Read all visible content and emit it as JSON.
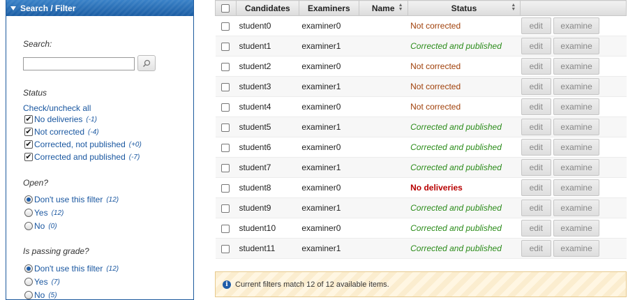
{
  "sidebar": {
    "title": "Search / Filter",
    "search_label": "Search:",
    "search_value": "",
    "status_label": "Status",
    "check_uncheck_all": "Check/uncheck all",
    "status_options": [
      {
        "label": "No deliveries",
        "count": "(-1)"
      },
      {
        "label": "Not corrected",
        "count": "(-4)"
      },
      {
        "label": "Corrected, not published",
        "count": "(+0)"
      },
      {
        "label": "Corrected and published",
        "count": "(-7)"
      }
    ],
    "open_label": "Open?",
    "open_options": [
      {
        "label": "Don't use this filter",
        "count": "(12)",
        "selected": true
      },
      {
        "label": "Yes",
        "count": "(12)",
        "selected": false
      },
      {
        "label": "No",
        "count": "(0)",
        "selected": false
      }
    ],
    "passing_label": "Is passing grade?",
    "passing_options": [
      {
        "label": "Don't use this filter",
        "count": "(12)",
        "selected": true
      },
      {
        "label": "Yes",
        "count": "(7)",
        "selected": false
      },
      {
        "label": "No",
        "count": "(5)",
        "selected": false
      }
    ]
  },
  "table": {
    "headers": [
      "Candidates",
      "Examiners",
      "Name",
      "Status"
    ],
    "edit_label": "edit",
    "examine_label": "examine",
    "rows": [
      {
        "candidate": "student0",
        "examiner": "examiner0",
        "status": "Not corrected",
        "kind": "nc"
      },
      {
        "candidate": "student1",
        "examiner": "examiner1",
        "status": "Corrected and published",
        "kind": "cp"
      },
      {
        "candidate": "student2",
        "examiner": "examiner0",
        "status": "Not corrected",
        "kind": "nc"
      },
      {
        "candidate": "student3",
        "examiner": "examiner1",
        "status": "Not corrected",
        "kind": "nc"
      },
      {
        "candidate": "student4",
        "examiner": "examiner0",
        "status": "Not corrected",
        "kind": "nc"
      },
      {
        "candidate": "student5",
        "examiner": "examiner1",
        "status": "Corrected and published",
        "kind": "cp"
      },
      {
        "candidate": "student6",
        "examiner": "examiner0",
        "status": "Corrected and published",
        "kind": "cp"
      },
      {
        "candidate": "student7",
        "examiner": "examiner1",
        "status": "Corrected and published",
        "kind": "cp"
      },
      {
        "candidate": "student8",
        "examiner": "examiner0",
        "status": "No deliveries",
        "kind": "nd"
      },
      {
        "candidate": "student9",
        "examiner": "examiner1",
        "status": "Corrected and published",
        "kind": "cp"
      },
      {
        "candidate": "student10",
        "examiner": "examiner0",
        "status": "Corrected and published",
        "kind": "cp"
      },
      {
        "candidate": "student11",
        "examiner": "examiner1",
        "status": "Corrected and published",
        "kind": "cp"
      }
    ]
  },
  "info": {
    "message": "Current filters match 12 of 12 available items."
  },
  "colors": {
    "header_blue": "#1b5da3",
    "not_corrected": "#a0400a",
    "published": "#2b8c1a",
    "no_deliveries": "#b80000"
  }
}
